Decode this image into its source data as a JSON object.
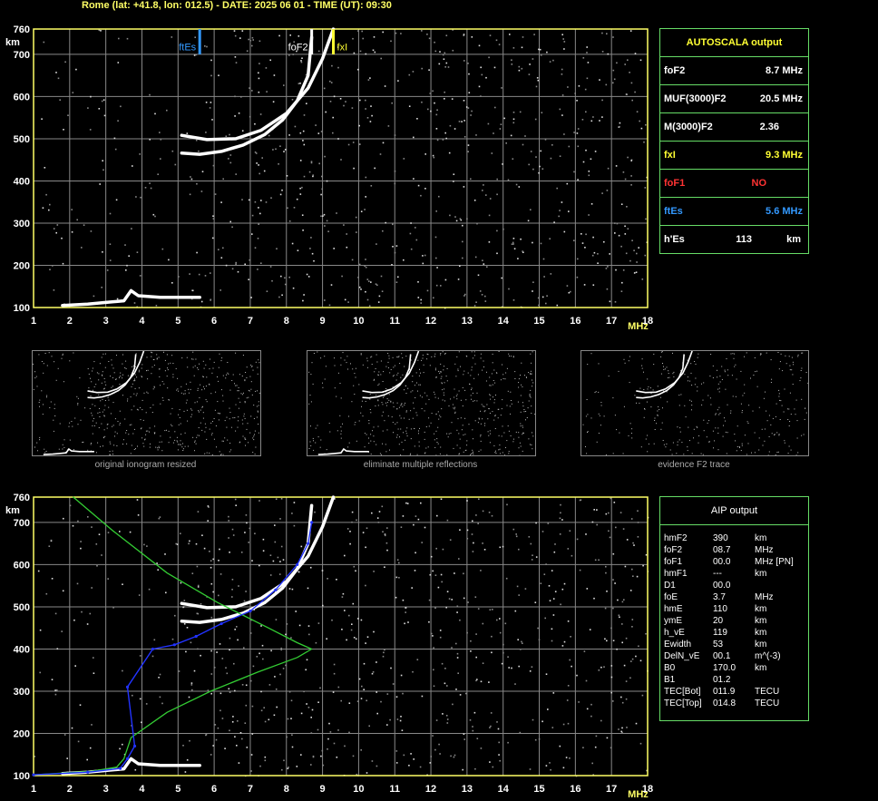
{
  "title": "Rome (lat: +41.8, lon: 012.5) - DATE: 2025 06 01 - TIME (UT): 09:30",
  "axes": {
    "y_label": "km",
    "y_top_label": "760",
    "x_unit_label": "MHz",
    "x_last_label": "18",
    "x_ticks": [
      "1",
      "2",
      "3",
      "4",
      "5",
      "6",
      "7",
      "8",
      "9",
      "10",
      "11",
      "12",
      "13",
      "14",
      "15",
      "16",
      "17"
    ],
    "y_ticks": [
      "700",
      "600",
      "500",
      "400",
      "300",
      "200",
      "100"
    ]
  },
  "markers": {
    "ftEs": "ftEs",
    "foF2": "foF2",
    "fxI": "fxI"
  },
  "autoscala": {
    "header": "AUTOSCALA output",
    "rows": [
      {
        "label": "foF2",
        "value": "8.7 MHz",
        "color": "#ffffff"
      },
      {
        "label": "MUF(3000)F2",
        "value": "20.5 MHz",
        "color": "#ffffff"
      },
      {
        "label": "M(3000)F2",
        "value": "2.36",
        "color": "#ffffff"
      },
      {
        "label": "fxI",
        "value": "9.3 MHz",
        "color": "#ffff33"
      },
      {
        "label": "foF1",
        "value": "NO",
        "color": "#ff3333"
      },
      {
        "label": "ftEs",
        "value": "5.6 MHz",
        "color": "#3399ff"
      },
      {
        "label": "h'Es",
        "value": "113",
        "unit": "km",
        "color": "#ffffff"
      }
    ]
  },
  "thumbnails": [
    {
      "caption": "original ionogram resized"
    },
    {
      "caption": "eliminate multiple reflections"
    },
    {
      "caption": "evidence F2 trace"
    }
  ],
  "aip": {
    "header": "AIP output",
    "rows": [
      {
        "name": "hmF2",
        "value": "390",
        "unit": "km"
      },
      {
        "name": "foF2",
        "value": "08.7",
        "unit": "MHz"
      },
      {
        "name": "foF1",
        "value": "00.0",
        "unit": "MHz   [PN]"
      },
      {
        "name": "hmF1",
        "value": "---",
        "unit": "km"
      },
      {
        "name": "D1",
        "value": "00.0",
        "unit": ""
      },
      {
        "name": "foE",
        "value": "3.7",
        "unit": "MHz"
      },
      {
        "name": "hmE",
        "value": "110",
        "unit": "km"
      },
      {
        "name": "ymE",
        "value": "20",
        "unit": "km"
      },
      {
        "name": "h_vE",
        "value": "119",
        "unit": "km"
      },
      {
        "name": "Ewidth",
        "value": "53",
        "unit": "km"
      },
      {
        "name": "DelN_vE",
        "value": "00.1",
        "unit": "m^(-3)"
      },
      {
        "name": "B0",
        "value": "170.0",
        "unit": "km"
      },
      {
        "name": "B1",
        "value": "01.2",
        "unit": ""
      },
      {
        "name": "TEC[Bot]",
        "value": "011.9",
        "unit": "TECU"
      },
      {
        "name": "TEC[Top]",
        "value": "014.8",
        "unit": "TECU"
      }
    ]
  },
  "colors": {
    "frame": "#ffff66",
    "grid": "#888888",
    "trace": "#ffffff",
    "ftEs_marker": "#3399ff",
    "fxI_marker": "#ffff33",
    "profile": "#33cc33",
    "fit": "#2233ff",
    "table_border": "#66dd66"
  },
  "chart_data": [
    {
      "type": "scatter",
      "xlabel": "MHz",
      "ylabel": "km",
      "xlim": [
        1,
        18
      ],
      "ylim": [
        100,
        760
      ],
      "grid": true,
      "series": [
        {
          "name": "foF2",
          "points": [
            [
              5.1,
              466
            ],
            [
              5.6,
              463
            ],
            [
              6.2,
              470
            ],
            [
              6.8,
              485
            ],
            [
              7.4,
              510
            ],
            [
              7.9,
              545
            ],
            [
              8.3,
              590
            ],
            [
              8.6,
              650
            ],
            [
              8.7,
              740
            ]
          ]
        },
        {
          "name": "fxI",
          "points": [
            [
              5.1,
              508
            ],
            [
              5.8,
              498
            ],
            [
              6.6,
              500
            ],
            [
              7.3,
              520
            ],
            [
              8.0,
              560
            ],
            [
              8.6,
              620
            ],
            [
              9.0,
              690
            ],
            [
              9.3,
              760
            ]
          ]
        },
        {
          "name": "ftEs",
          "points": [
            [
              1.8,
              105
            ],
            [
              2.5,
              108
            ],
            [
              3.0,
              112
            ],
            [
              3.5,
              116
            ],
            [
              3.7,
              140
            ],
            [
              3.9,
              128
            ],
            [
              4.5,
              124
            ],
            [
              5.2,
              124
            ],
            [
              5.6,
              124
            ]
          ]
        }
      ],
      "markers": [
        {
          "name": "ftEs",
          "x": 5.6
        },
        {
          "name": "foF2",
          "x": 8.7
        },
        {
          "name": "fxI",
          "x": 9.3
        }
      ]
    },
    {
      "type": "line",
      "xlabel": "MHz",
      "ylabel": "km",
      "xlim": [
        1,
        18
      ],
      "ylim": [
        100,
        760
      ],
      "grid": true,
      "series": [
        {
          "name": "AIP profile",
          "points": [
            [
              2.1,
              760
            ],
            [
              3.2,
              680
            ],
            [
              4.7,
              580
            ],
            [
              6.1,
              510
            ],
            [
              7.5,
              450
            ],
            [
              8.3,
              415
            ],
            [
              8.7,
              400
            ],
            [
              8.3,
              380
            ],
            [
              7.2,
              345
            ],
            [
              5.9,
              300
            ],
            [
              4.7,
              250
            ],
            [
              3.7,
              190
            ],
            [
              3.5,
              140
            ],
            [
              3.3,
              120
            ],
            [
              2.6,
              110
            ],
            [
              1.0,
              102
            ]
          ]
        },
        {
          "name": "fitted trace",
          "points": [
            [
              1.0,
              102
            ],
            [
              2.5,
              108
            ],
            [
              3.4,
              117
            ],
            [
              3.6,
              140
            ],
            [
              3.8,
              170
            ],
            [
              3.6,
              310
            ],
            [
              4.3,
              400
            ],
            [
              4.9,
              410
            ],
            [
              5.5,
              430
            ],
            [
              6.2,
              460
            ],
            [
              7.0,
              490
            ],
            [
              7.7,
              540
            ],
            [
              8.3,
              600
            ],
            [
              8.6,
              650
            ],
            [
              8.7,
              700
            ]
          ]
        }
      ]
    }
  ]
}
